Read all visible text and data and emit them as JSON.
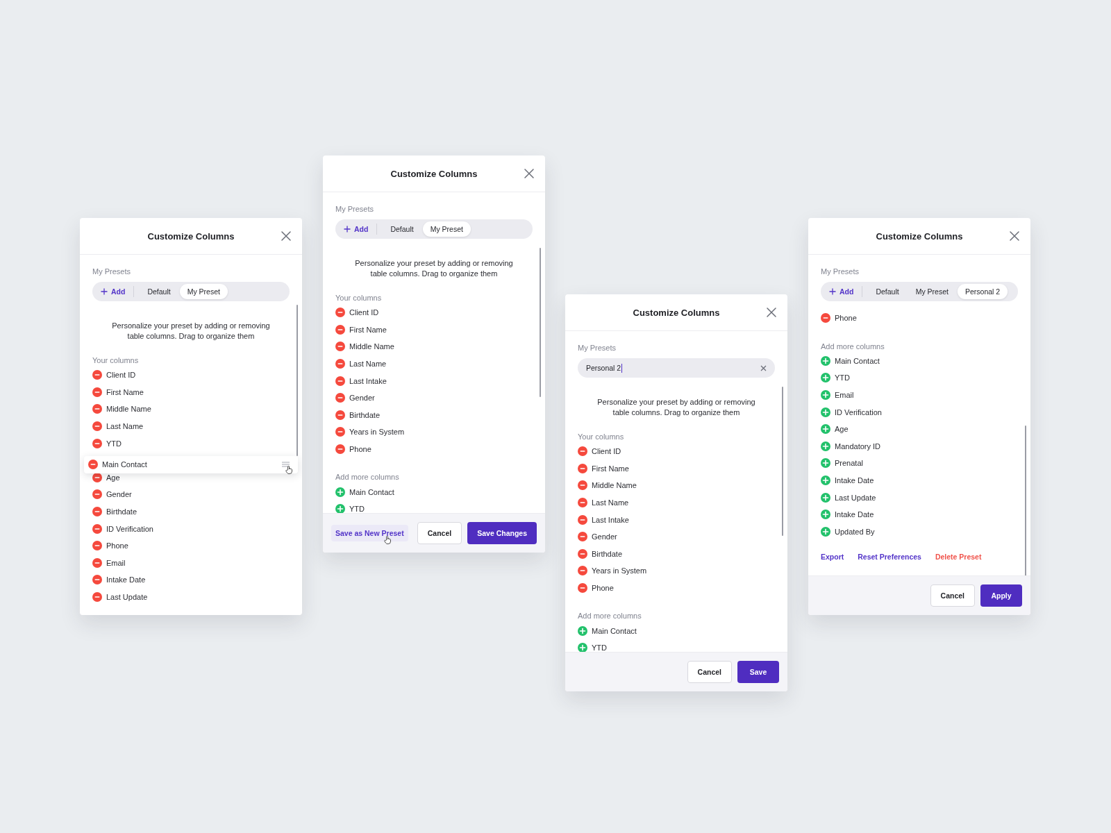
{
  "panels": [
    {
      "title": "Customize Columns",
      "presets_label": "My Presets",
      "presets": {
        "add_label": "Add",
        "items": [
          {
            "label": "Default",
            "selected": false
          },
          {
            "label": "My Preset",
            "selected": true
          }
        ]
      },
      "description": "Personalize your preset by adding or removing table columns. Drag to organize them",
      "sections": [
        {
          "heading": "Your columns",
          "items": [
            {
              "label": "Client ID",
              "kind": "remove",
              "dragging": false
            },
            {
              "label": "First Name",
              "kind": "remove",
              "dragging": false
            },
            {
              "label": "Middle Name",
              "kind": "remove",
              "dragging": false
            },
            {
              "label": "Last Name",
              "kind": "remove",
              "dragging": false
            },
            {
              "label": "YTD",
              "kind": "remove",
              "dragging": false
            },
            {
              "label": "Main Contact",
              "kind": "remove",
              "dragging": true
            },
            {
              "label": "Age",
              "kind": "remove",
              "dragging": false
            },
            {
              "label": "Gender",
              "kind": "remove",
              "dragging": false
            },
            {
              "label": "Birthdate",
              "kind": "remove",
              "dragging": false
            },
            {
              "label": "ID Verification",
              "kind": "remove",
              "dragging": false
            },
            {
              "label": "Phone",
              "kind": "remove",
              "dragging": false
            },
            {
              "label": "Email",
              "kind": "remove",
              "dragging": false
            },
            {
              "label": "Intake Date",
              "kind": "remove",
              "dragging": false
            },
            {
              "label": "Last Update",
              "kind": "remove",
              "dragging": false
            }
          ]
        }
      ]
    },
    {
      "title": "Customize Columns",
      "presets_label": "My Presets",
      "presets": {
        "add_label": "Add",
        "items": [
          {
            "label": "Default",
            "selected": false
          },
          {
            "label": "My Preset",
            "selected": true
          }
        ]
      },
      "description": "Personalize your preset by adding or removing table columns. Drag to organize them",
      "sections": [
        {
          "heading": "Your columns",
          "items": [
            {
              "label": "Client ID",
              "kind": "remove"
            },
            {
              "label": "First Name",
              "kind": "remove"
            },
            {
              "label": "Middle Name",
              "kind": "remove"
            },
            {
              "label": "Last Name",
              "kind": "remove"
            },
            {
              "label": "Last Intake",
              "kind": "remove"
            },
            {
              "label": "Gender",
              "kind": "remove"
            },
            {
              "label": "Birthdate",
              "kind": "remove"
            },
            {
              "label": "Years in System",
              "kind": "remove"
            },
            {
              "label": "Phone",
              "kind": "remove"
            }
          ]
        },
        {
          "heading": "Add more columns",
          "items": [
            {
              "label": "Main Contact",
              "kind": "add"
            },
            {
              "label": "YTD",
              "kind": "add"
            }
          ]
        }
      ],
      "buttons": [
        {
          "label": "Save as New Preset",
          "kind": "ghost"
        },
        {
          "label": "Cancel",
          "kind": "secondary"
        },
        {
          "label": "Save Changes",
          "kind": "primary"
        }
      ]
    },
    {
      "title": "Customize Columns",
      "presets_label": "My Presets",
      "preset_name_field": {
        "value": "Personal 2"
      },
      "description": "Personalize your preset by adding or removing table columns. Drag to organize them",
      "sections": [
        {
          "heading": "Your columns",
          "items": [
            {
              "label": "Client ID",
              "kind": "remove"
            },
            {
              "label": "First Name",
              "kind": "remove"
            },
            {
              "label": "Middle Name",
              "kind": "remove"
            },
            {
              "label": "Last Name",
              "kind": "remove"
            },
            {
              "label": "Last Intake",
              "kind": "remove"
            },
            {
              "label": "Gender",
              "kind": "remove"
            },
            {
              "label": "Birthdate",
              "kind": "remove"
            },
            {
              "label": "Years in System",
              "kind": "remove"
            },
            {
              "label": "Phone",
              "kind": "remove"
            }
          ]
        },
        {
          "heading": "Add more columns",
          "items": [
            {
              "label": "Main Contact",
              "kind": "add"
            },
            {
              "label": "YTD",
              "kind": "add"
            }
          ]
        }
      ],
      "buttons": [
        {
          "label": "Cancel",
          "kind": "secondary"
        },
        {
          "label": "Save",
          "kind": "primary"
        }
      ]
    },
    {
      "title": "Customize Columns",
      "presets_label": "My Presets",
      "presets": {
        "add_label": "Add",
        "items": [
          {
            "label": "Default",
            "selected": false
          },
          {
            "label": "My Preset",
            "selected": false
          },
          {
            "label": "Personal 2",
            "selected": true
          }
        ]
      },
      "sections": [
        {
          "items": [
            {
              "label": "Phone",
              "kind": "remove"
            }
          ]
        },
        {
          "heading": "Add more columns",
          "items": [
            {
              "label": "Main Contact",
              "kind": "add"
            },
            {
              "label": "YTD",
              "kind": "add"
            },
            {
              "label": "Email",
              "kind": "add"
            },
            {
              "label": "ID Verification",
              "kind": "add"
            },
            {
              "label": "Age",
              "kind": "add"
            },
            {
              "label": "Mandatory ID",
              "kind": "add"
            },
            {
              "label": "Prenatal",
              "kind": "add"
            },
            {
              "label": "Intake Date",
              "kind": "add"
            },
            {
              "label": "Last Update",
              "kind": "add"
            },
            {
              "label": "Intake Date",
              "kind": "add"
            },
            {
              "label": "Updated By",
              "kind": "add"
            }
          ]
        }
      ],
      "links": [
        {
          "label": "Export",
          "kind": "primary"
        },
        {
          "label": "Reset Preferences",
          "kind": "primary"
        },
        {
          "label": "Delete Preset",
          "kind": "danger"
        }
      ],
      "buttons": [
        {
          "label": "Cancel",
          "kind": "secondary"
        },
        {
          "label": "Apply",
          "kind": "primary"
        }
      ]
    }
  ]
}
